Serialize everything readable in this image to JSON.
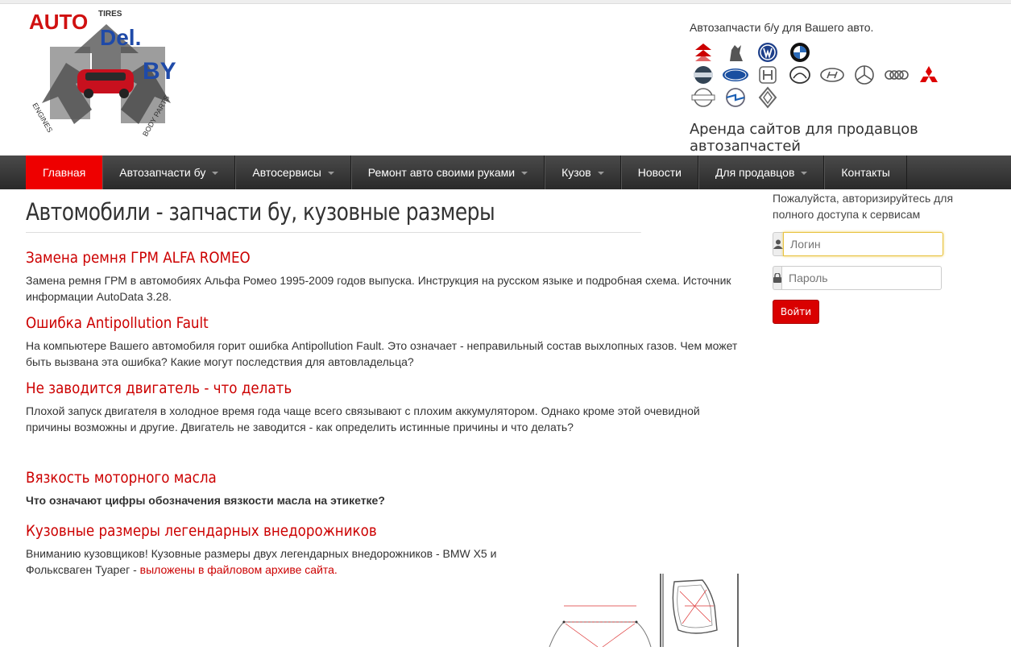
{
  "header": {
    "logo": {
      "word1": "AUTO",
      "word2": "Del.",
      "word3": "BY",
      "tires": "TIRES",
      "engines": "ENGINES",
      "body_parts": "BODY PARTS"
    },
    "tagline": "Автозапчасти б/у для Вашего авто.",
    "rent": "Аренда сайтов для продавцов автозапчастей",
    "brand_icons": [
      "citroen-icon",
      "peugeot-icon",
      "volkswagen-icon",
      "bmw-icon",
      "volvo-icon",
      "ford-icon",
      "honda-icon",
      "mazda-icon",
      "hyundai-icon",
      "mercedes-icon",
      "audi-icon",
      "mitsubishi-icon",
      "nissan-icon",
      "opel-icon",
      "renault-icon"
    ]
  },
  "nav": {
    "items": [
      {
        "label": "Главная",
        "active": true,
        "dropdown": false
      },
      {
        "label": "Автозапчасти бу",
        "dropdown": true
      },
      {
        "label": "Автосервисы",
        "dropdown": true
      },
      {
        "label": "Ремонт авто своими руками",
        "dropdown": true
      },
      {
        "label": "Кузов",
        "dropdown": true
      },
      {
        "label": "Новости",
        "dropdown": false
      },
      {
        "label": "Для продавцов",
        "dropdown": true
      },
      {
        "label": "Контакты",
        "dropdown": false
      }
    ]
  },
  "main": {
    "page_title": "Автомобили - запчасти бу, кузовные размеры",
    "articles": [
      {
        "title": "Замена ремня ГРМ ALFA ROMEO",
        "text": "Замена ремня ГРМ в автомобиях Альфа Ромео 1995-2009 годов выпуска. Инструкция на русском языке и подробная схема. Источник информации AutoData 3.28."
      },
      {
        "title": "Ошибка Antipollution Fault",
        "text": "На компьютере Вашего автомобиля горит ошибка Antipollution Fault. Это означает - неправильный состав выхлопных газов. Чем может быть вызвана эта ошибка? Какие могут последствия для автовладельца?"
      },
      {
        "title": "Не заводится двигатель - что делать",
        "text": "Плохой запуск двигателя в холодное время года чаще всего связывают с плохим аккумулятором. Однако кроме этой очевидной причины возможны и другие. Двигатель не заводится - как определить истинные причины и что делать?"
      },
      {
        "title": "Вязкость моторного масла",
        "text": "Что означают цифры обозначения вязкости масла на этикетке?"
      },
      {
        "title": "Кузовные размеры легендарных внедорожников",
        "text": "Вниманию кузовщиков! Кузовные размеры двух легендарных внедорожников - BMW X5 и Фольксваген Туарег - ",
        "link": "выложены в файловом архиве сайта."
      }
    ]
  },
  "sidebar": {
    "note": "Пожалуйста, авторизируйтесь для полного доступа к сервисам",
    "login_placeholder": "Логин",
    "password_placeholder": "Пароль",
    "submit": "Войти"
  },
  "colors": {
    "accent": "#cc0000",
    "nav_bg": "#333333",
    "active": "#ee0000"
  }
}
